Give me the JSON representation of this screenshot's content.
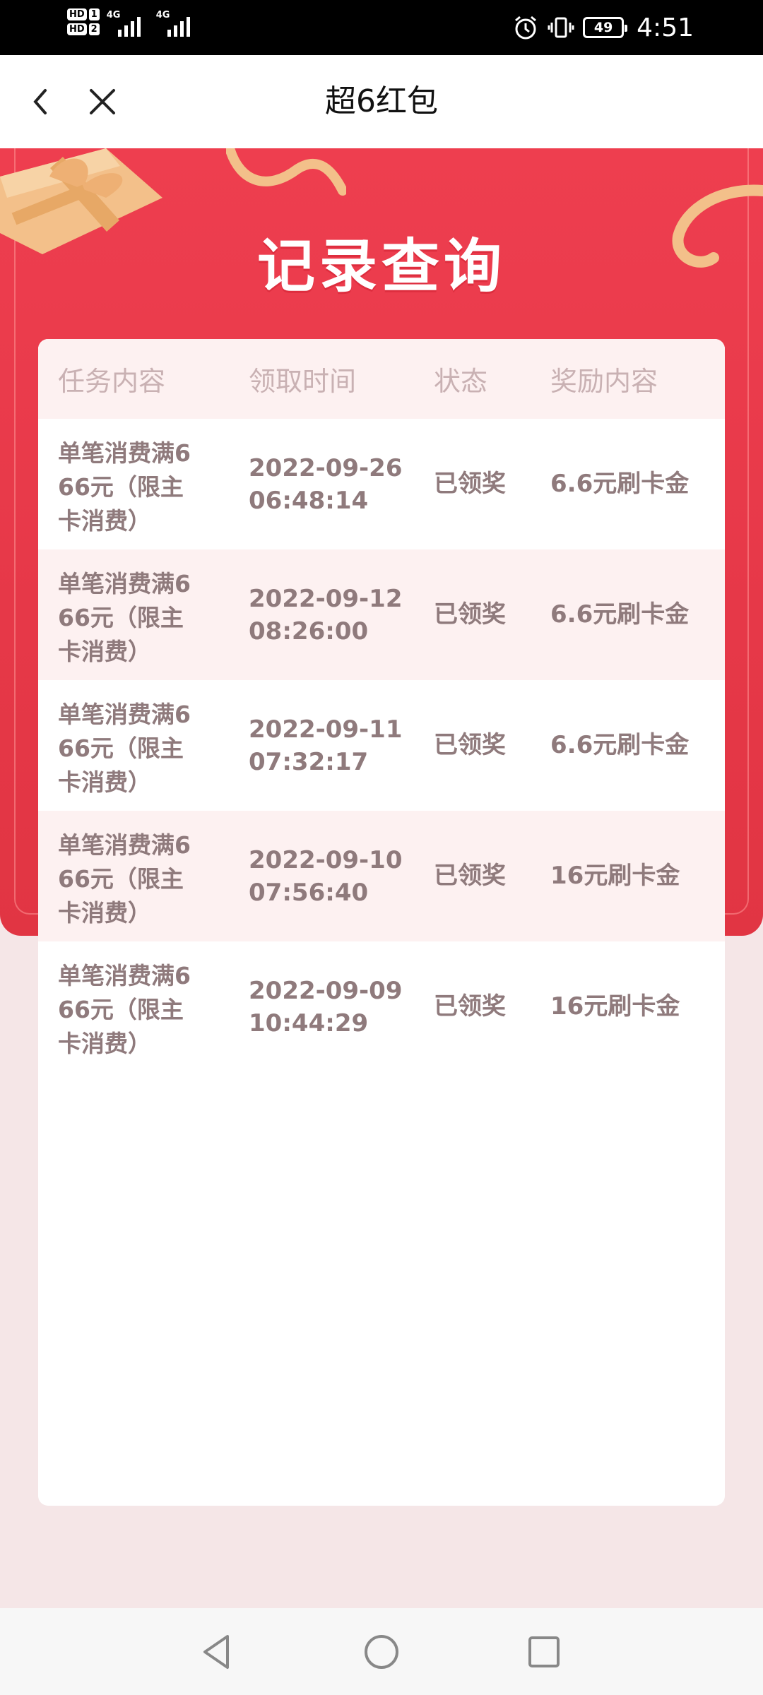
{
  "status_bar": {
    "sim1": "HD",
    "sim1_num": "1",
    "sim2": "HD",
    "sim2_num": "2",
    "net1": "4G",
    "net2": "4G",
    "battery": "49",
    "time": "4:51"
  },
  "header": {
    "title": "超6红包"
  },
  "banner": {
    "title": "记录查询"
  },
  "table": {
    "headers": [
      "任务内容",
      "领取时间",
      "状态",
      "奖励内容"
    ],
    "rows": [
      {
        "task": "单笔消费满666元（限主卡消费）",
        "date": "2022-09-26",
        "time": "06:48:14",
        "status": "已领奖",
        "reward": "6.6元刷卡金"
      },
      {
        "task": "单笔消费满666元（限主卡消费）",
        "date": "2022-09-12",
        "time": "08:26:00",
        "status": "已领奖",
        "reward": "6.6元刷卡金"
      },
      {
        "task": "单笔消费满666元（限主卡消费）",
        "date": "2022-09-11",
        "time": "07:32:17",
        "status": "已领奖",
        "reward": "6.6元刷卡金"
      },
      {
        "task": "单笔消费满666元（限主卡消费）",
        "date": "2022-09-10",
        "time": "07:56:40",
        "status": "已领奖",
        "reward": "16元刷卡金"
      },
      {
        "task": "单笔消费满666元（限主卡消费）",
        "date": "2022-09-09",
        "time": "10:44:29",
        "status": "已领奖",
        "reward": "16元刷卡金"
      }
    ]
  },
  "icons": {
    "back": "chevron-left-icon",
    "close": "close-icon",
    "alarm": "alarm-icon",
    "vibrate": "vibrate-icon",
    "nav_back": "triangle-back-icon",
    "nav_home": "circle-home-icon",
    "nav_recent": "square-recent-icon"
  },
  "colors": {
    "banner_red": "#e63848",
    "table_stripe": "#fdf1f1",
    "header_text": "#c9b1b3",
    "row_text": "#8f7a7c"
  }
}
